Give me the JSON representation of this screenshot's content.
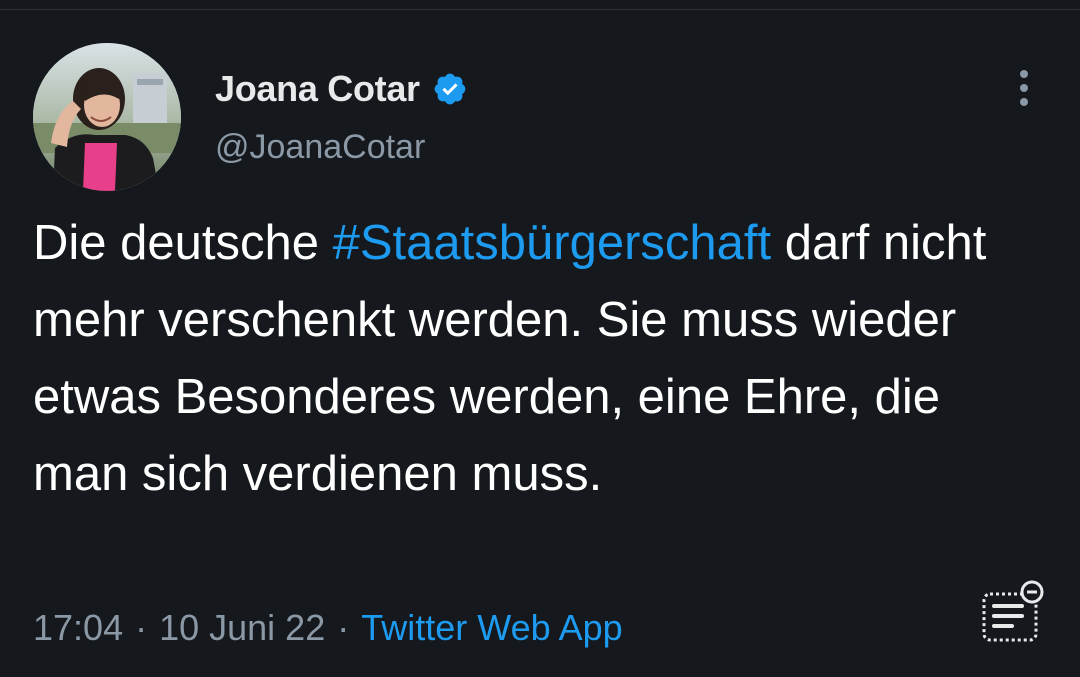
{
  "tweet": {
    "author": {
      "display_name": "Joana Cotar",
      "handle": "@JoanaCotar",
      "verified_icon": "verified-badge-icon"
    },
    "text_plain_1": "Die deutsche ",
    "hashtag": "#Staatsbürgerschaft",
    "text_plain_2": " darf nicht mehr verschenkt werden. Sie muss wieder etwas Besonderes werden, eine Ehre, die man sich verdienen muss.",
    "time": "17:04",
    "separator_1": "·",
    "date": "10 Juni 22",
    "separator_2": "·",
    "source": "Twitter Web App"
  },
  "icons": {
    "more": "more-vertical-icon",
    "note": "note-list-icon"
  },
  "colors": {
    "background": "#15181c",
    "link": "#1d9bf0",
    "secondary_text": "#8b98a5"
  }
}
